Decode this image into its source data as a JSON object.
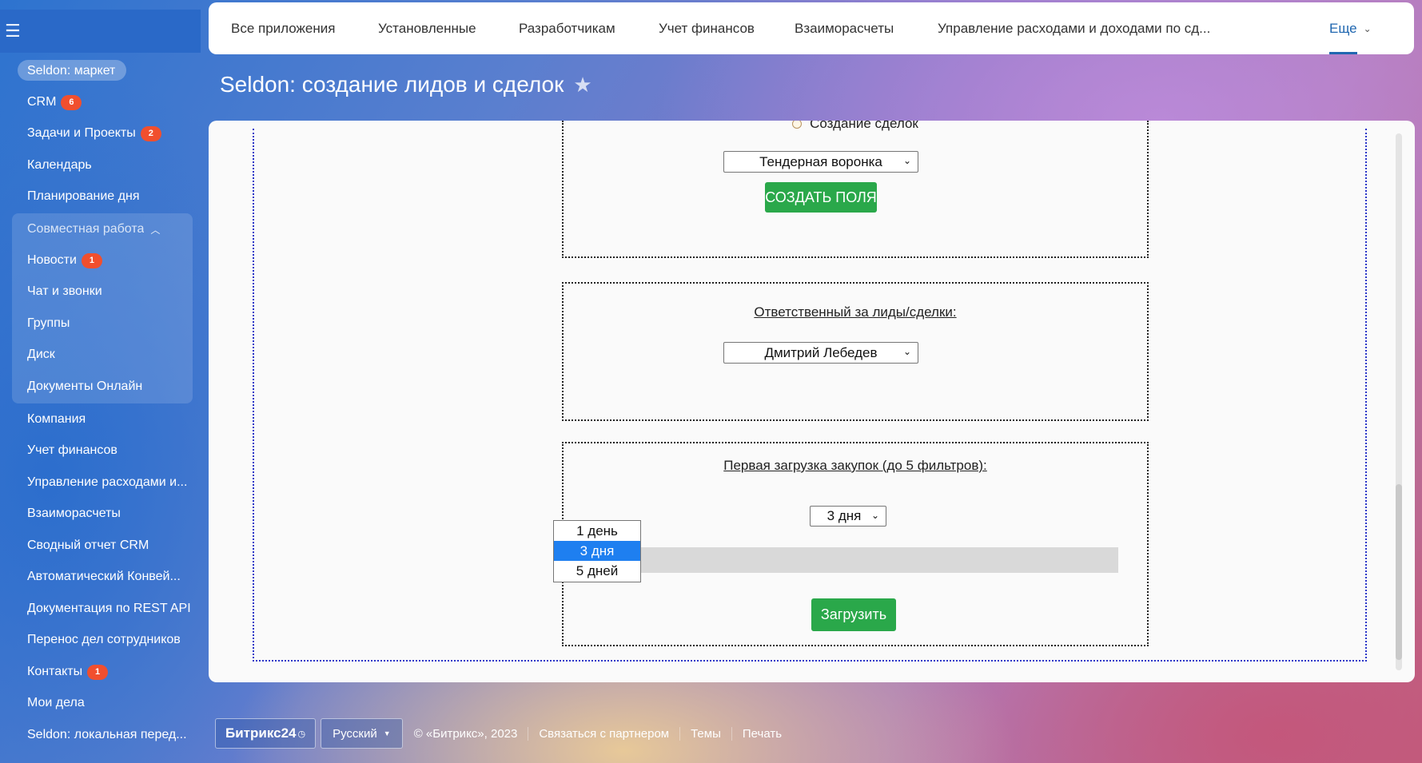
{
  "sidebar": {
    "menu_icon": "hamburger-icon",
    "items": [
      {
        "label": "Seldon: маркет",
        "badge": ""
      },
      {
        "label": "CRM",
        "badge": "6"
      },
      {
        "label": "Задачи и Проекты",
        "badge": "2"
      },
      {
        "label": "Календарь",
        "badge": ""
      },
      {
        "label": "Планирование дня",
        "badge": ""
      },
      {
        "label": "Совместная работа",
        "badge": ""
      },
      {
        "label": "Новости",
        "badge": "1"
      },
      {
        "label": "Чат и звонки",
        "badge": ""
      },
      {
        "label": "Группы",
        "badge": ""
      },
      {
        "label": "Диск",
        "badge": ""
      },
      {
        "label": "Документы Онлайн",
        "badge": ""
      },
      {
        "label": "Компания",
        "badge": ""
      },
      {
        "label": "Учет финансов",
        "badge": ""
      },
      {
        "label": "Управление расходами и...",
        "badge": ""
      },
      {
        "label": "Взаиморасчеты",
        "badge": ""
      },
      {
        "label": "Сводный отчет CRM",
        "badge": ""
      },
      {
        "label": "Автоматический Конвей...",
        "badge": ""
      },
      {
        "label": "Документация по REST API",
        "badge": ""
      },
      {
        "label": "Перенос дел сотрудников",
        "badge": ""
      },
      {
        "label": "Контакты",
        "badge": "1"
      },
      {
        "label": "Мои дела",
        "badge": ""
      },
      {
        "label": "Seldon: локальная перед...",
        "badge": ""
      }
    ]
  },
  "topnav": {
    "tabs": [
      "Все приложения",
      "Установленные",
      "Разработчикам",
      "Учет финансов",
      "Взаиморасчеты",
      "Управление расходами и доходами по сд..."
    ],
    "more_label": "Еще"
  },
  "page": {
    "title": "Seldon: создание лидов и сделок"
  },
  "section1": {
    "radio_label": "Создание сделок",
    "pipeline_select": "Тендерная воронка",
    "create_button": "СОЗДАТЬ ПОЛЯ"
  },
  "section2": {
    "label": "Ответственный за лиды/сделки:",
    "responsible_select": "Дмитрий Лебедев"
  },
  "section3": {
    "label": "Первая загрузка закупок (до 5 фильтров):",
    "period_select": "3 дня",
    "period_options": [
      "1 день",
      "3 дня",
      "5 дней"
    ],
    "load_button": "Загрузить"
  },
  "footer": {
    "logo": "Битрикс24",
    "language": "Русский",
    "copyright": "© «Битрикс», 2023",
    "partner_link": "Связаться с партнером",
    "themes_link": "Темы",
    "print_link": "Печать"
  }
}
